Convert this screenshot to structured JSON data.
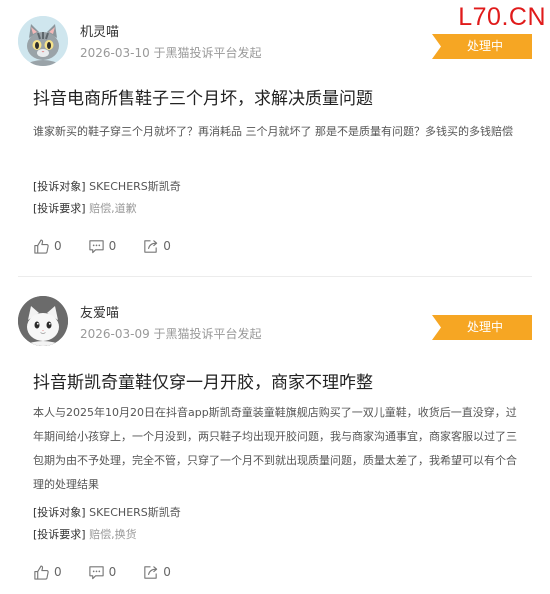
{
  "watermark": "L70.CN",
  "posts": [
    {
      "author": "机灵喵",
      "meta": "2026-03-10 于黑猫投诉平台发起",
      "status": "处理中",
      "title": "抖音电商所售鞋子三个月坏，求解决质量问题",
      "body": "谁家新买的鞋子穿三个月就坏了？再消耗品 三个月就坏了 那是不是质量有问题？多钱买的多钱赔偿",
      "target_label": "[投诉对象]",
      "target_value": "SKECHERS斯凯奇",
      "demand_label": "[投诉要求]",
      "demand_value": "赔偿,道歉",
      "likes": "0",
      "comments": "0",
      "shares": "0",
      "icons": [
        "like-icon",
        "comment-icon",
        "share-icon"
      ]
    },
    {
      "author": "友爱喵",
      "meta": "2026-03-09 于黑猫投诉平台发起",
      "status": "处理中",
      "title": "抖音斯凯奇童鞋仅穿一月开胶，商家不理咋整",
      "body": "本人与2025年10月20日在抖音app斯凯奇童装童鞋旗舰店购买了一双儿童鞋，收货后一直没穿，过年期间给小孩穿上，一个月没到，两只鞋子均出现开胶问题，我与商家沟通事宜，商家客服以过了三包期为由不予处理，完全不管，只穿了一个月不到就出现质量问题，质量太差了，我希望可以有个合理的处理结果",
      "target_label": "[投诉对象]",
      "target_value": "SKECHERS斯凯奇",
      "demand_label": "[投诉要求]",
      "demand_value": "赔偿,换货",
      "likes": "0",
      "comments": "0",
      "shares": "0",
      "icons": [
        "like-icon",
        "comment-icon",
        "share-icon"
      ]
    }
  ],
  "colors": {
    "status_badge": "#f6a623",
    "watermark": "#e01b1b"
  }
}
